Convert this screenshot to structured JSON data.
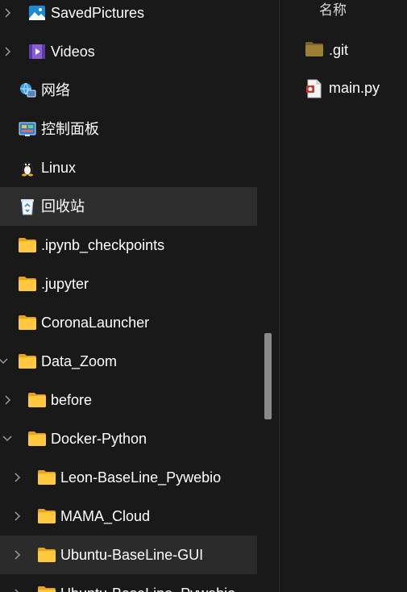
{
  "navigation": {
    "items": [
      {
        "label": "SavedPictures",
        "icon": "pictures-icon",
        "chevron": "right"
      },
      {
        "label": "Videos",
        "icon": "videos-icon",
        "chevron": "right"
      },
      {
        "label": "网络",
        "icon": "network-icon",
        "chevron": ""
      },
      {
        "label": "控制面板",
        "icon": "control-panel-icon",
        "chevron": ""
      },
      {
        "label": "Linux",
        "icon": "linux-penguin-icon",
        "chevron": ""
      },
      {
        "label": "回收站",
        "icon": "recycle-bin-icon",
        "chevron": "",
        "state": "selected"
      },
      {
        "label": ".ipynb_checkpoints",
        "icon": "folder-icon",
        "chevron": ""
      },
      {
        "label": ".jupyter",
        "icon": "folder-icon",
        "chevron": ""
      },
      {
        "label": "CoronaLauncher",
        "icon": "folder-icon",
        "chevron": ""
      },
      {
        "label": "Data_Zoom",
        "icon": "folder-icon",
        "chevron": "down"
      },
      {
        "label": "before",
        "icon": "folder-icon",
        "chevron": "right"
      },
      {
        "label": "Docker-Python",
        "icon": "folder-icon",
        "chevron": "down"
      },
      {
        "label": "Leon-BaseLine_Pywebio",
        "icon": "folder-icon",
        "chevron": "right"
      },
      {
        "label": "MAMA_Cloud",
        "icon": "folder-icon",
        "chevron": "right"
      },
      {
        "label": "Ubuntu-BaseLine-GUI",
        "icon": "folder-icon",
        "chevron": "right",
        "state": "hover"
      },
      {
        "label": "Ubuntu-BaseLine_Pywebio",
        "icon": "folder-icon",
        "chevron": "right"
      }
    ]
  },
  "content": {
    "column_header": "名称",
    "files": [
      {
        "name": ".git",
        "icon": "folder-icon"
      },
      {
        "name": "main.py",
        "icon": "python-file-icon"
      }
    ]
  },
  "colors": {
    "background": "#191919",
    "selected_row": "#2d2d2d",
    "folder": "#ffc83d",
    "scrollbar_thumb": "#8a8a8a"
  }
}
